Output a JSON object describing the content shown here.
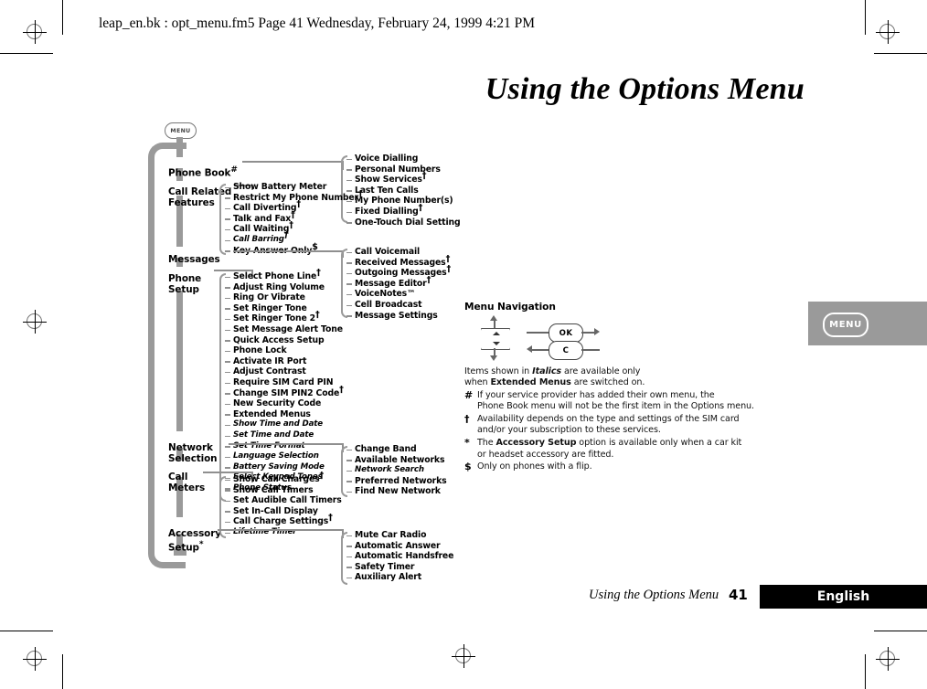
{
  "header_line": "leap_en.bk : opt_menu.fm5  Page 41  Wednesday, February 24, 1999  4:21 PM",
  "page_title": "Using the Options Menu",
  "menu_tab": {
    "label": "MENU"
  },
  "tree": {
    "root_button": "MENU",
    "top_level": [
      {
        "label": "Phone Book",
        "marker": "#"
      },
      {
        "label": "Call Related\nFeatures",
        "marker": ""
      },
      {
        "label": "Messages",
        "marker": ""
      },
      {
        "label": "Phone\nSetup",
        "marker": ""
      },
      {
        "label": "Network\nSelection",
        "marker": ""
      },
      {
        "label": "Call\nMeters",
        "marker": ""
      },
      {
        "label": "Accessory\nSetup",
        "marker": "*"
      }
    ],
    "phone_book_items": [
      {
        "label": "Voice Dialling",
        "dagger": false,
        "italic": false
      },
      {
        "label": "Personal Numbers",
        "dagger": false,
        "italic": false
      },
      {
        "label": "Show Services",
        "dagger": true,
        "italic": false
      },
      {
        "label": "Last Ten Calls",
        "dagger": false,
        "italic": false
      },
      {
        "label": "My Phone Number(s)",
        "dagger": false,
        "italic": false
      },
      {
        "label": "Fixed Dialling",
        "dagger": true,
        "italic": false
      },
      {
        "label": "One-Touch Dial Setting",
        "dagger": false,
        "italic": false
      }
    ],
    "call_related_items": [
      {
        "label": "Show Battery Meter",
        "dagger": false,
        "italic": false
      },
      {
        "label": "Restrict My Phone Number",
        "dagger": true,
        "italic": false
      },
      {
        "label": "Call Diverting",
        "dagger": true,
        "italic": false
      },
      {
        "label": "Talk and Fax",
        "dagger": true,
        "italic": false
      },
      {
        "label": "Call Waiting",
        "dagger": true,
        "italic": false
      },
      {
        "label": "Call Barring",
        "dagger": true,
        "italic": true
      },
      {
        "label": "Key Answer Only",
        "dollar": true,
        "dagger": false,
        "italic": false
      }
    ],
    "messages_items": [
      {
        "label": "Call Voicemail",
        "dagger": false,
        "italic": false
      },
      {
        "label": "Received Messages",
        "dagger": true,
        "italic": false
      },
      {
        "label": "Outgoing Messages",
        "dagger": true,
        "italic": false
      },
      {
        "label": "Message Editor",
        "dagger": true,
        "italic": false
      },
      {
        "label": "VoiceNotes™",
        "dagger": false,
        "italic": false
      },
      {
        "label": "Cell Broadcast",
        "dagger": false,
        "italic": false
      },
      {
        "label": "Message Settings",
        "dagger": false,
        "italic": false
      }
    ],
    "phone_setup_items": [
      {
        "label": "Select Phone Line",
        "dagger": true,
        "italic": false
      },
      {
        "label": "Adjust Ring Volume",
        "dagger": false,
        "italic": false
      },
      {
        "label": "Ring Or Vibrate",
        "dagger": false,
        "italic": false
      },
      {
        "label": "Set Ringer Tone",
        "dagger": false,
        "italic": false
      },
      {
        "label": "Set Ringer Tone 2",
        "dagger": true,
        "italic": false
      },
      {
        "label": "Set Message Alert Tone",
        "dagger": false,
        "italic": false
      },
      {
        "label": "Quick Access Setup",
        "dagger": false,
        "italic": false
      },
      {
        "label": "Phone Lock",
        "dagger": false,
        "italic": false
      },
      {
        "label": "Activate IR Port",
        "dagger": false,
        "italic": false
      },
      {
        "label": "Adjust Contrast",
        "dagger": false,
        "italic": false
      },
      {
        "label": "Require SIM Card PIN",
        "dagger": false,
        "italic": false
      },
      {
        "label": "Change SIM PIN2 Code",
        "dagger": true,
        "italic": false
      },
      {
        "label": "New Security Code",
        "dagger": false,
        "italic": false
      },
      {
        "label": "Extended Menus",
        "dagger": false,
        "italic": false
      },
      {
        "label": "Show Time and Date",
        "dagger": false,
        "italic": true
      },
      {
        "label": "Set Time and Date",
        "dagger": false,
        "italic": true
      },
      {
        "label": "Set Time Format",
        "dagger": false,
        "italic": true
      },
      {
        "label": "Language Selection",
        "dagger": false,
        "italic": true
      },
      {
        "label": "Battery Saving Mode",
        "dagger": false,
        "italic": true
      },
      {
        "label": "Select Keypad Tones",
        "dagger": false,
        "italic": true
      },
      {
        "label": "Phone Status",
        "dagger": false,
        "italic": true
      }
    ],
    "network_selection_items": [
      {
        "label": "Change Band",
        "dagger": false,
        "italic": false
      },
      {
        "label": "Available Networks",
        "dagger": false,
        "italic": false
      },
      {
        "label": "Network Search",
        "dagger": false,
        "italic": true
      },
      {
        "label": "Preferred Networks",
        "dagger": false,
        "italic": false
      },
      {
        "label": "Find New Network",
        "dagger": false,
        "italic": false
      }
    ],
    "call_meters_items": [
      {
        "label": "Show Call Charges",
        "dagger": true,
        "italic": false
      },
      {
        "label": "Show Call Timers",
        "dagger": false,
        "italic": false
      },
      {
        "label": "Set Audible Call Timers",
        "dagger": false,
        "italic": false
      },
      {
        "label": "Set In-Call Display",
        "dagger": false,
        "italic": false
      },
      {
        "label": "Call Charge Settings",
        "dagger": true,
        "italic": false
      },
      {
        "label": "Lifetime Timer",
        "dagger": false,
        "italic": true
      }
    ],
    "accessory_setup_items": [
      {
        "label": "Mute Car Radio",
        "dagger": false,
        "italic": false
      },
      {
        "label": "Automatic Answer",
        "dagger": false,
        "italic": false
      },
      {
        "label": "Automatic Handsfree",
        "dagger": false,
        "italic": false
      },
      {
        "label": "Safety Timer",
        "dagger": false,
        "italic": false
      },
      {
        "label": "Auxiliary Alert",
        "dagger": false,
        "italic": false
      }
    ]
  },
  "legend": {
    "title": "Menu Navigation",
    "ok_key": "OK",
    "clear_key": "C",
    "italics_note_parts": {
      "p1": "Items shown in ",
      "em1": "Italics",
      "p2": " are available only",
      "p3": "when ",
      "em2": "Extended Menus",
      "p4": " are switched on."
    },
    "footnotes": [
      {
        "mark": "#",
        "line1": "If your service provider has added their own menu, the",
        "line2": "Phone Book menu will not be the first item in the Options menu."
      },
      {
        "mark": "†",
        "line1": "Availability depends on the type and settings of the SIM card",
        "line2": "and/or your subscription to these services."
      },
      {
        "mark": "*",
        "line1_a": "The ",
        "line1_em": "Accessory Setup",
        "line1_b": " option is available only when a car kit",
        "line2": "or headset accessory are fitted."
      },
      {
        "mark": "$",
        "line1": "Only on phones with a flip.",
        "line2": ""
      }
    ]
  },
  "footer": {
    "section": "Using the Options Menu",
    "page_number": "41",
    "language": "English"
  },
  "colors": {
    "spine_gray": "#9a9a9a",
    "footer_bar": "#000000",
    "tab_gray": "#9a9a9a"
  }
}
